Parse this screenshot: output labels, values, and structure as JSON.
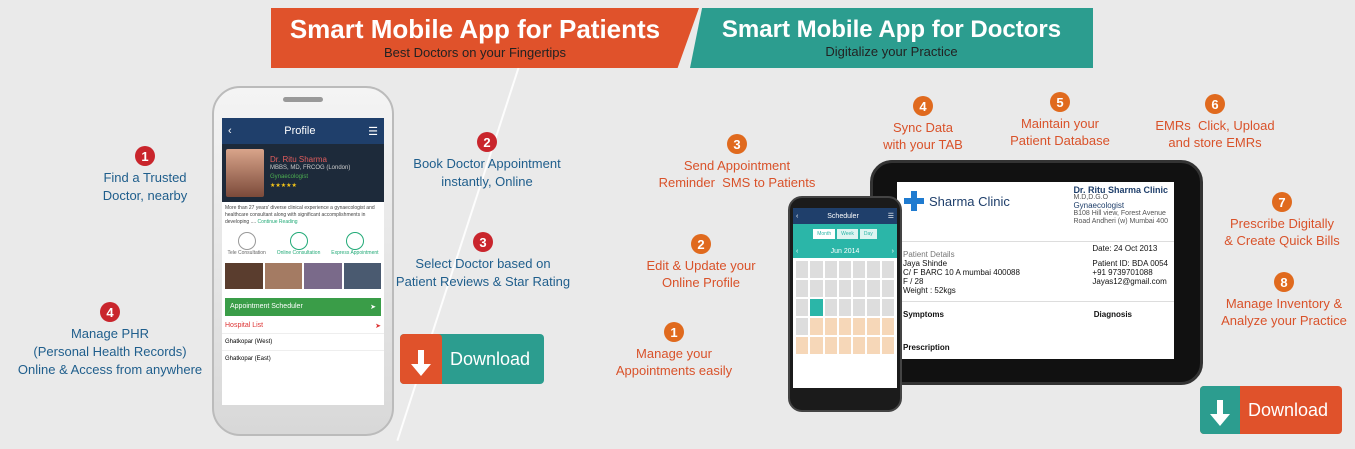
{
  "banners": {
    "patients_title": "Smart Mobile App for Patients",
    "patients_sub": "Best Doctors on your Fingertips",
    "doctors_title": "Smart Mobile App for Doctors",
    "doctors_sub": "Digitalize your Practice"
  },
  "patient_features": [
    {
      "num": "1",
      "text": "Find a Trusted\nDoctor, nearby"
    },
    {
      "num": "2",
      "text": "Book Doctor Appointment\ninstantly, Online"
    },
    {
      "num": "3",
      "text": "Select Doctor based on\nPatient Reviews & Star Rating"
    },
    {
      "num": "4",
      "text": "Manage PHR\n(Personal Health Records)\nOnline & Access from anywhere"
    }
  ],
  "doctor_features": [
    {
      "num": "1",
      "text": "Manage your\nAppointments easily"
    },
    {
      "num": "2",
      "text": "Edit & Update your\nOnline Profile"
    },
    {
      "num": "3",
      "text": "Send Appointment\nReminder  SMS to Patients"
    },
    {
      "num": "4",
      "text": "Sync Data\nwith your TAB"
    },
    {
      "num": "5",
      "text": "Maintain your\nPatient Database"
    },
    {
      "num": "6",
      "text": "EMRs  Click, Upload\nand store EMRs"
    },
    {
      "num": "7",
      "text": "Prescribe Digitally\n& Create Quick Bills"
    },
    {
      "num": "8",
      "text": "Manage Inventory &\nAnalyze your Practice"
    }
  ],
  "download_label": "Download",
  "patient_phone": {
    "title": "Profile",
    "doctor_name": "Dr. Ritu Sharma",
    "qual": "MBBS, MD, FRCOG (London)",
    "spec": "Gynaecologist",
    "rating": "★★★★★",
    "bio": "More than 27 years' diverse clinical experience a gynaecologist and healthcare consultant along with significant accomplishments in developing ....",
    "more": "Continue Reading",
    "consult": [
      "Tele Consultation",
      "Online Consultation",
      "Express Appointment"
    ],
    "scheduler": "Appointment Scheduler",
    "hospital_list": "Hospital List",
    "hospitals": [
      "Ghatkopar (West)",
      "Ghatkopar (East)"
    ]
  },
  "doctor_phone": {
    "title": "Scheduler",
    "tabs": [
      "Month",
      "Week",
      "Day"
    ],
    "month": "Jun 2014"
  },
  "tablet": {
    "clinic": "Sharma Clinic",
    "doctor": "Dr. Ritu Sharma Clinic",
    "degree": "M.D,D.G.O",
    "spec": "Gynaecologist",
    "address1": "B108 Hill view, Forest Avenue",
    "address2": "Road Andheri (w) Mumbai  400",
    "date": "Date: 24 Oct 2013",
    "details_label": "Patient Details",
    "patient_name": "Jaya Shinde",
    "patient_addr": "C/ F BARC 10 A mumbai 400088",
    "patient_age": "F / 28",
    "patient_weight": "Weight : 52kgs",
    "patient_id": "Patient ID: BDA 0054",
    "phone": "+91 9739701088",
    "email": "Jayas12@gmail.com",
    "symptoms": "Symptoms",
    "diagnosis": "Diagnosis",
    "prescription": "Prescription"
  },
  "colors": {
    "orange": "#e0522b",
    "teal": "#2c9d8f",
    "blue": "#1f5e8c"
  }
}
